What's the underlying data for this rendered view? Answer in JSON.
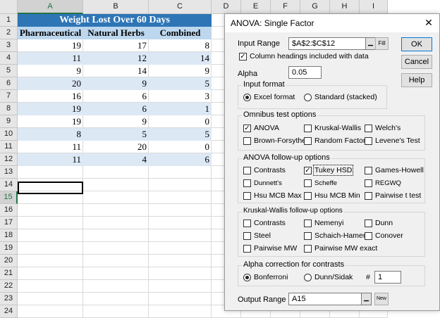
{
  "sheet": {
    "columns": [
      "A",
      "B",
      "C",
      "D",
      "E",
      "F",
      "G",
      "H",
      "I"
    ],
    "rows": [
      "1",
      "2",
      "3",
      "4",
      "5",
      "6",
      "7",
      "8",
      "9",
      "10",
      "11",
      "12",
      "13",
      "14",
      "15",
      "16",
      "17",
      "18",
      "19",
      "20",
      "21",
      "22",
      "23",
      "24"
    ],
    "title": "Weight Lost Over 60 Days",
    "headers": [
      "Pharmaceutical",
      "Natural Herbs",
      "Combined"
    ],
    "data": [
      [
        "19",
        "17",
        "8"
      ],
      [
        "11",
        "12",
        "14"
      ],
      [
        "9",
        "14",
        "9"
      ],
      [
        "20",
        "9",
        "5"
      ],
      [
        "16",
        "6",
        "3"
      ],
      [
        "19",
        "6",
        "1"
      ],
      [
        "19",
        "9",
        "0"
      ],
      [
        "8",
        "5",
        "5"
      ],
      [
        "11",
        "20",
        "0"
      ],
      [
        "11",
        "4",
        "6"
      ]
    ],
    "colors": {
      "title_bg": "#2e75b6",
      "header_bg": "#bdd7ee",
      "band_bg": "#dde8f5",
      "selected": "#217346"
    }
  },
  "dialog": {
    "title": "ANOVA: Single Factor",
    "close": "✕",
    "input_range_label": "Input Range",
    "input_range_value": "$A$2:$C$12",
    "fill_button": "Fill",
    "headings_label": "Column headings included with data",
    "headings_checked": "✓",
    "alpha_label": "Alpha",
    "alpha_value": "0.05",
    "ok": "OK",
    "cancel": "Cancel",
    "help": "Help",
    "input_format": {
      "title": "Input format",
      "excel": "Excel format",
      "standard": "Standard (stacked)"
    },
    "omnibus": {
      "title": "Omnibus test options",
      "anova": "ANOVA",
      "kruskal": "Kruskal-Wallis",
      "welch": "Welch's",
      "brown": "Brown-Forsythe",
      "random": "Random Factor",
      "levene": "Levene's Test"
    },
    "followup": {
      "title": "ANOVA follow-up options",
      "contrasts": "Contrasts",
      "tukey": "Tukey HSD",
      "games": "Games-Howell",
      "dunnett": "Dunnett's",
      "scheffe": "Scheffe",
      "regwq": "REGWQ",
      "hsu_max": "Hsu MCB Max",
      "hsu_min": "Hsu MCB Min",
      "pairwise": "Pairwise t test"
    },
    "kw_followup": {
      "title": "Kruskal-Wallis follow-up options",
      "contrasts": "Contrasts",
      "nemenyi": "Nemenyi",
      "dunn": "Dunn",
      "steel": "Steel",
      "schaich": "Schaich-Hamerle",
      "conover": "Conover",
      "pairwise_mw": "Pairwise MW",
      "pairwise_mw_exact": "Pairwise MW exact"
    },
    "alpha_corr": {
      "title": "Alpha correction for contrasts",
      "bonferroni": "Bonferroni",
      "dunn_sidak": "Dunn/Sidak",
      "hash": "#",
      "count": "1"
    },
    "output_range_label": "Output Range",
    "output_range_value": "A15",
    "new_button": "New",
    "check_mark": "✓",
    "dropdown_glyph": "▁"
  }
}
